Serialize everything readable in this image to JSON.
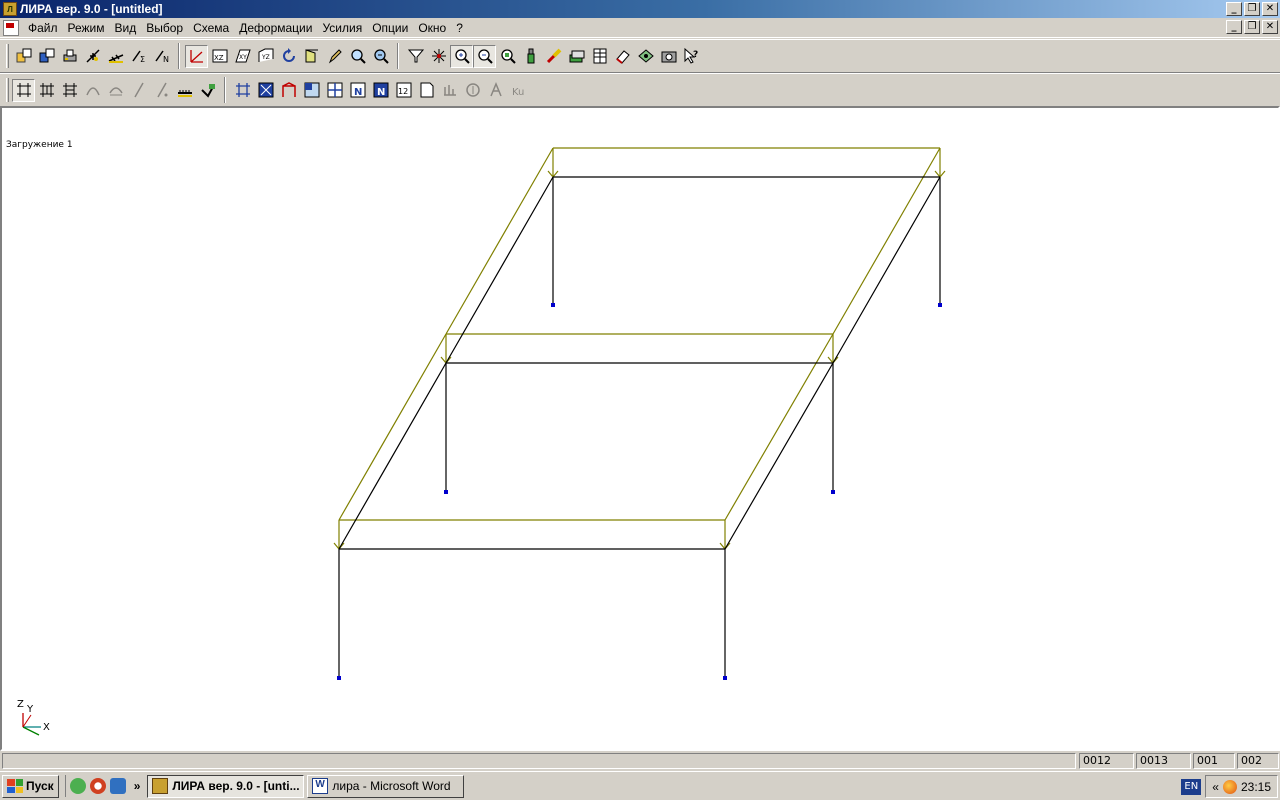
{
  "window": {
    "title": "ЛИРА  вер. 9.0 - [untitled]",
    "app_icon": "lira-app-icon"
  },
  "menu": {
    "items": [
      "Файл",
      "Режим",
      "Вид",
      "Выбор",
      "Схема",
      "Деформации",
      "Усилия",
      "Опции",
      "Окно",
      "?"
    ]
  },
  "toolbar1": {
    "groups": [
      [
        "scheme-open-icon",
        "scheme-save-icon",
        "print-icon",
        "load-icon",
        "load-case-icon",
        "sum-load-icon",
        "n-load-icon"
      ],
      [
        "axes-icon",
        "xz-plane-icon",
        "xyz-plane-icon",
        "yz-plane-icon",
        "rotate-icon",
        "projection-icon",
        "pencil-icon",
        "zoom-icon",
        "zoom-fit-icon"
      ],
      [
        "filter-icon",
        "star-node-icon",
        "zoom-in-icon",
        "zoom-out-icon",
        "zoom-window-icon",
        "bottle-icon",
        "brush-icon",
        "layers-icon",
        "table-icon",
        "erase-icon",
        "section-icon",
        "camera-icon",
        "help-cursor-icon"
      ]
    ],
    "pressed": [
      "axes-icon",
      "zoom-in-icon",
      "zoom-out-icon"
    ]
  },
  "toolbar2": {
    "groups": [
      [
        "grid-a-icon",
        "grid-b-icon",
        "grid-c-icon",
        "curve-icon",
        "curve-hatch-icon",
        "slash-icon",
        "slash-dot-icon",
        "ruler-icon",
        "tick-flag-icon"
      ],
      [
        "frame-grid-icon",
        "fill-panel-icon",
        "arch-icon",
        "panel-blue-icon",
        "panel-grid-icon",
        "panel-n-icon",
        "panel-nb-icon",
        "panel-12-icon",
        "page-icon",
        "bars-dim-icon",
        "shield-dim-icon",
        "axes-dim-icon",
        "k-dim-icon"
      ]
    ],
    "pressed": [
      "grid-a-icon"
    ],
    "dimmed": [
      "curve-icon",
      "curve-hatch-icon",
      "slash-icon",
      "slash-dot-icon",
      "bars-dim-icon",
      "shield-dim-icon",
      "axes-dim-icon",
      "k-dim-icon"
    ]
  },
  "workspace": {
    "load_case_label": "Загружение  1",
    "frame_color": "#000000",
    "load_color": "#808000",
    "support_color": "#0000cc",
    "axis_labels": {
      "z": "Z",
      "y": "Y",
      "x": "X"
    }
  },
  "statusbar": {
    "cells": [
      "0012",
      "0013",
      "001",
      "002"
    ]
  },
  "taskbar": {
    "start_label": "Пуск",
    "quicklaunch": [
      "utorrent-icon",
      "opera-icon",
      "network-icon"
    ],
    "more": "»",
    "tasks": [
      {
        "label": "ЛИРА  вер. 9.0 - [unti...",
        "active": true
      },
      {
        "label": "лира - Microsoft Word",
        "active": false
      }
    ],
    "lang": "EN",
    "tray_more": "«",
    "clock": "23:15"
  }
}
